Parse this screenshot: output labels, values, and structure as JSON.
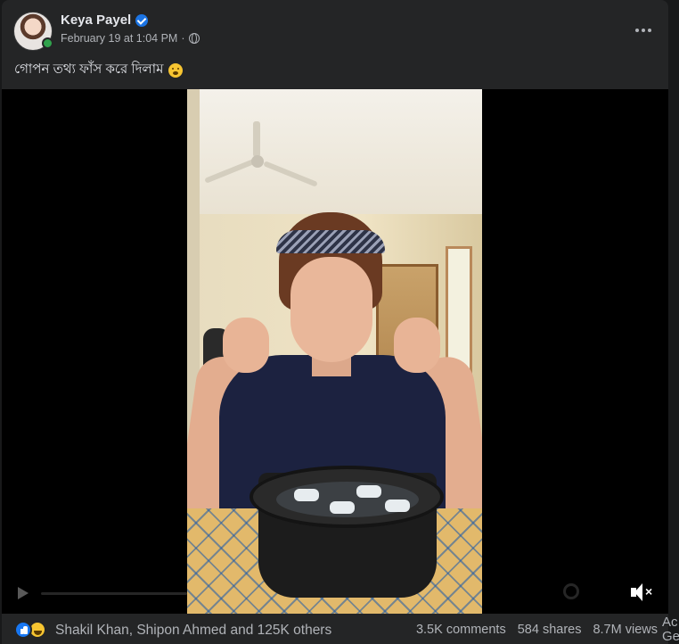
{
  "post": {
    "author": "Keya Payel",
    "timestamp": "February 19 at 1:04 PM",
    "separator": "·",
    "caption": "গোপন তথ্য ফাঁস করে দিলাম"
  },
  "video": {
    "muted": true
  },
  "footer": {
    "reactions_text": "Shakil Khan, Shipon Ahmed and 125K others",
    "comments": "3.5K comments",
    "shares": "584 shares",
    "views": "8.7M views"
  },
  "overflow_text": "Ac Ge",
  "icons": {
    "verified": "verified-badge-icon",
    "audience": "globe-icon",
    "more": "more-options-icon",
    "caption_emoji": "astonished-face-icon",
    "reactions": [
      "like-icon",
      "haha-icon"
    ],
    "mute": "speaker-muted-icon"
  },
  "colors": {
    "accent": "#1877f2",
    "card_bg": "#242526",
    "page_bg": "#18191a",
    "online": "#31a24c"
  }
}
